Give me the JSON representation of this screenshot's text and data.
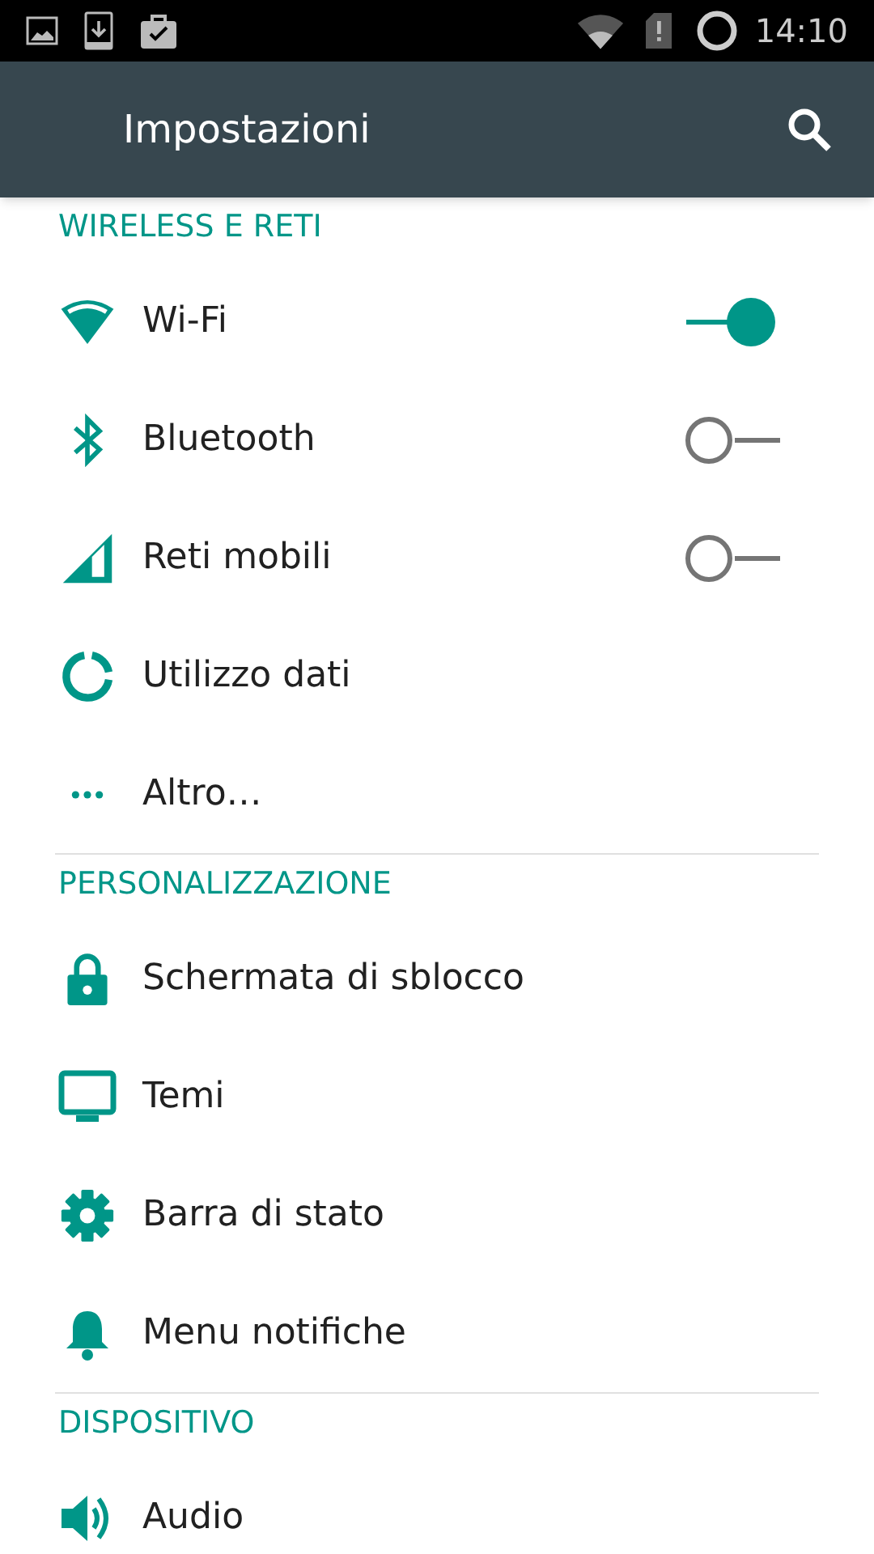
{
  "status_bar": {
    "time": "14:10"
  },
  "app_bar": {
    "title": "Impostazioni"
  },
  "sections": [
    {
      "title": "WIRELESS E RETI",
      "items": [
        {
          "label": "Wi-Fi",
          "kind": "toggle",
          "on": true
        },
        {
          "label": "Bluetooth",
          "kind": "toggle",
          "on": false
        },
        {
          "label": "Reti mobili",
          "kind": "toggle",
          "on": false
        },
        {
          "label": "Utilizzo dati",
          "kind": "link"
        },
        {
          "label": "Altro…",
          "kind": "link"
        }
      ]
    },
    {
      "title": "PERSONALIZZAZIONE",
      "items": [
        {
          "label": "Schermata di sblocco",
          "kind": "link"
        },
        {
          "label": "Temi",
          "kind": "link"
        },
        {
          "label": "Barra di stato",
          "kind": "link"
        },
        {
          "label": "Menu notifiche",
          "kind": "link"
        }
      ]
    },
    {
      "title": "DISPOSITIVO",
      "items": [
        {
          "label": "Audio",
          "kind": "link"
        }
      ]
    }
  ]
}
